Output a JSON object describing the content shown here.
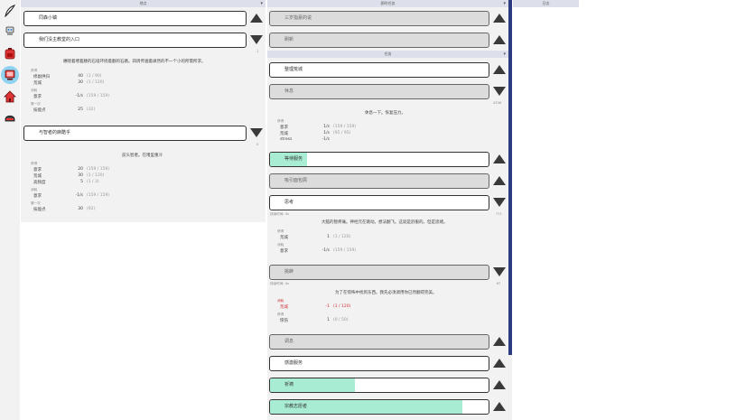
{
  "nav": {
    "items": [
      {
        "name": "feather-icon",
        "active": false
      },
      {
        "name": "robot-icon",
        "active": false
      },
      {
        "name": "backpack-icon",
        "active": false
      },
      {
        "name": "computer-icon",
        "active": true
      },
      {
        "name": "house-icon",
        "active": false
      },
      {
        "name": "helmet-icon",
        "active": false
      }
    ]
  },
  "left_col": {
    "header": "地点",
    "locations": [
      {
        "label": "同森小镇",
        "arrow": "up"
      },
      {
        "label": "我们没主教堂的入口",
        "arrow": "down"
      }
    ],
    "count1": "1",
    "desc1": "穗晓着堵着腰的石墙环绕着翻的石路。四周传遍着飒然的不一个小的所需所求。",
    "groups1": [
      {
        "cat": "获得",
        "rows": [
          {
            "k": "修副供归",
            "v": "40",
            "m": "(1 / 90)"
          },
          {
            "k": "荒城",
            "v": "30",
            "m": "(1 / 120)"
          }
        ]
      },
      {
        "cat": "消耗",
        "rows": [
          {
            "k": "意求",
            "v": "-1/s",
            "m": "(159 / 159)"
          }
        ]
      },
      {
        "cat": "第一次",
        "rows": [
          {
            "k": "技能点",
            "v": "25",
            "m": "(32)"
          }
        ]
      }
    ],
    "location3": {
      "label": "与智者的麻酷乎",
      "arrow": "down"
    },
    "count3": "0",
    "desc3": "前头智者。在堵里重冷",
    "groups3": [
      {
        "cat": "获得",
        "rows": [
          {
            "k": "意求",
            "v": "20",
            "m": "(159 / 159)"
          },
          {
            "k": "荒城",
            "v": "30",
            "m": "(1 / 120)"
          },
          {
            "k": "高频度",
            "v": "5",
            "m": "(1 / 3)"
          }
        ]
      },
      {
        "cat": "消耗",
        "rows": [
          {
            "k": "意求",
            "v": "-1/s",
            "m": "(159 / 159)"
          }
        ]
      },
      {
        "cat": "第一次",
        "rows": [
          {
            "k": "技能点",
            "v": "30",
            "m": "(92)"
          }
        ]
      }
    ]
  },
  "mid_col": {
    "header": "即时任务",
    "top_tasks": [
      {
        "label": "三岁指豪的说",
        "arrow": "up",
        "disabled": true
      },
      {
        "label": "刷新",
        "arrow": "up",
        "disabled": true
      }
    ],
    "sub_header": "任务",
    "tasks_a": [
      {
        "label": "整理荒城",
        "arrow": "up",
        "disabled": false,
        "fill": 0
      },
      {
        "label": "休息",
        "arrow": "down",
        "disabled": true,
        "fill": 0
      }
    ],
    "rest_count": "4336",
    "rest_desc": "休息一下。恢复压力。",
    "rest_groups": [
      {
        "cat": "获得",
        "rows": [
          {
            "k": "意求",
            "v": "1/s",
            "m": "(159 / 159)"
          },
          {
            "k": "荒城",
            "v": "1/s",
            "m": "(95 / 95)"
          },
          {
            "k": "stress",
            "v": "-1/s",
            "m": ""
          }
        ]
      }
    ],
    "tasks_b": [
      {
        "label": "等待服务",
        "arrow": "up",
        "disabled": false,
        "fill": 0.17
      },
      {
        "label": "吸引面包屑",
        "arrow": "up",
        "disabled": true,
        "fill": 0
      },
      {
        "label": "思考",
        "arrow": "down",
        "disabled": false,
        "fill": 0
      }
    ],
    "think_duration": "持续时间: 3s",
    "think_count": "771",
    "think_desc": "大脑的暂疼痛。神经元在跳动。想法翻飞。这就是舒服的。但是思绪。",
    "think_groups": [
      {
        "cat": "获得",
        "rows": [
          {
            "k": "荒城",
            "v": "1",
            "m": "(1 / 120)"
          }
        ]
      },
      {
        "cat": "消耗",
        "rows": [
          {
            "k": "意求",
            "v": "-1/s",
            "m": "(159 / 159)"
          }
        ]
      }
    ],
    "task_c": {
      "label": "挑衅",
      "arrow": "down",
      "disabled": true,
      "fill": 0
    },
    "c_duration": "持续时间: 4s",
    "c_count": "67",
    "c_desc": "为了在惊怖中找到东西。我先必须调用你已然翻得完美。",
    "c_groups": [
      {
        "cat": "消耗",
        "red": true,
        "rows": [
          {
            "k": "荒城",
            "v": "-1",
            "m": "(1 / 120)"
          }
        ]
      },
      {
        "cat": "获得",
        "red": false,
        "rows": [
          {
            "k": "惊伤",
            "v": "1",
            "m": "(0 / 50)"
          }
        ]
      }
    ],
    "tasks_d": [
      {
        "label": "调息",
        "arrow": "up",
        "disabled": true,
        "fill": 0
      },
      {
        "label": "感激服务",
        "arrow": "up",
        "disabled": false,
        "fill": 0
      },
      {
        "label": "祈祷",
        "arrow": "up",
        "disabled": false,
        "fill": 0.39
      },
      {
        "label": "宗教志愿者",
        "arrow": "up",
        "disabled": false,
        "fill": 0.88
      }
    ]
  },
  "right_col": {
    "header": "日志"
  }
}
